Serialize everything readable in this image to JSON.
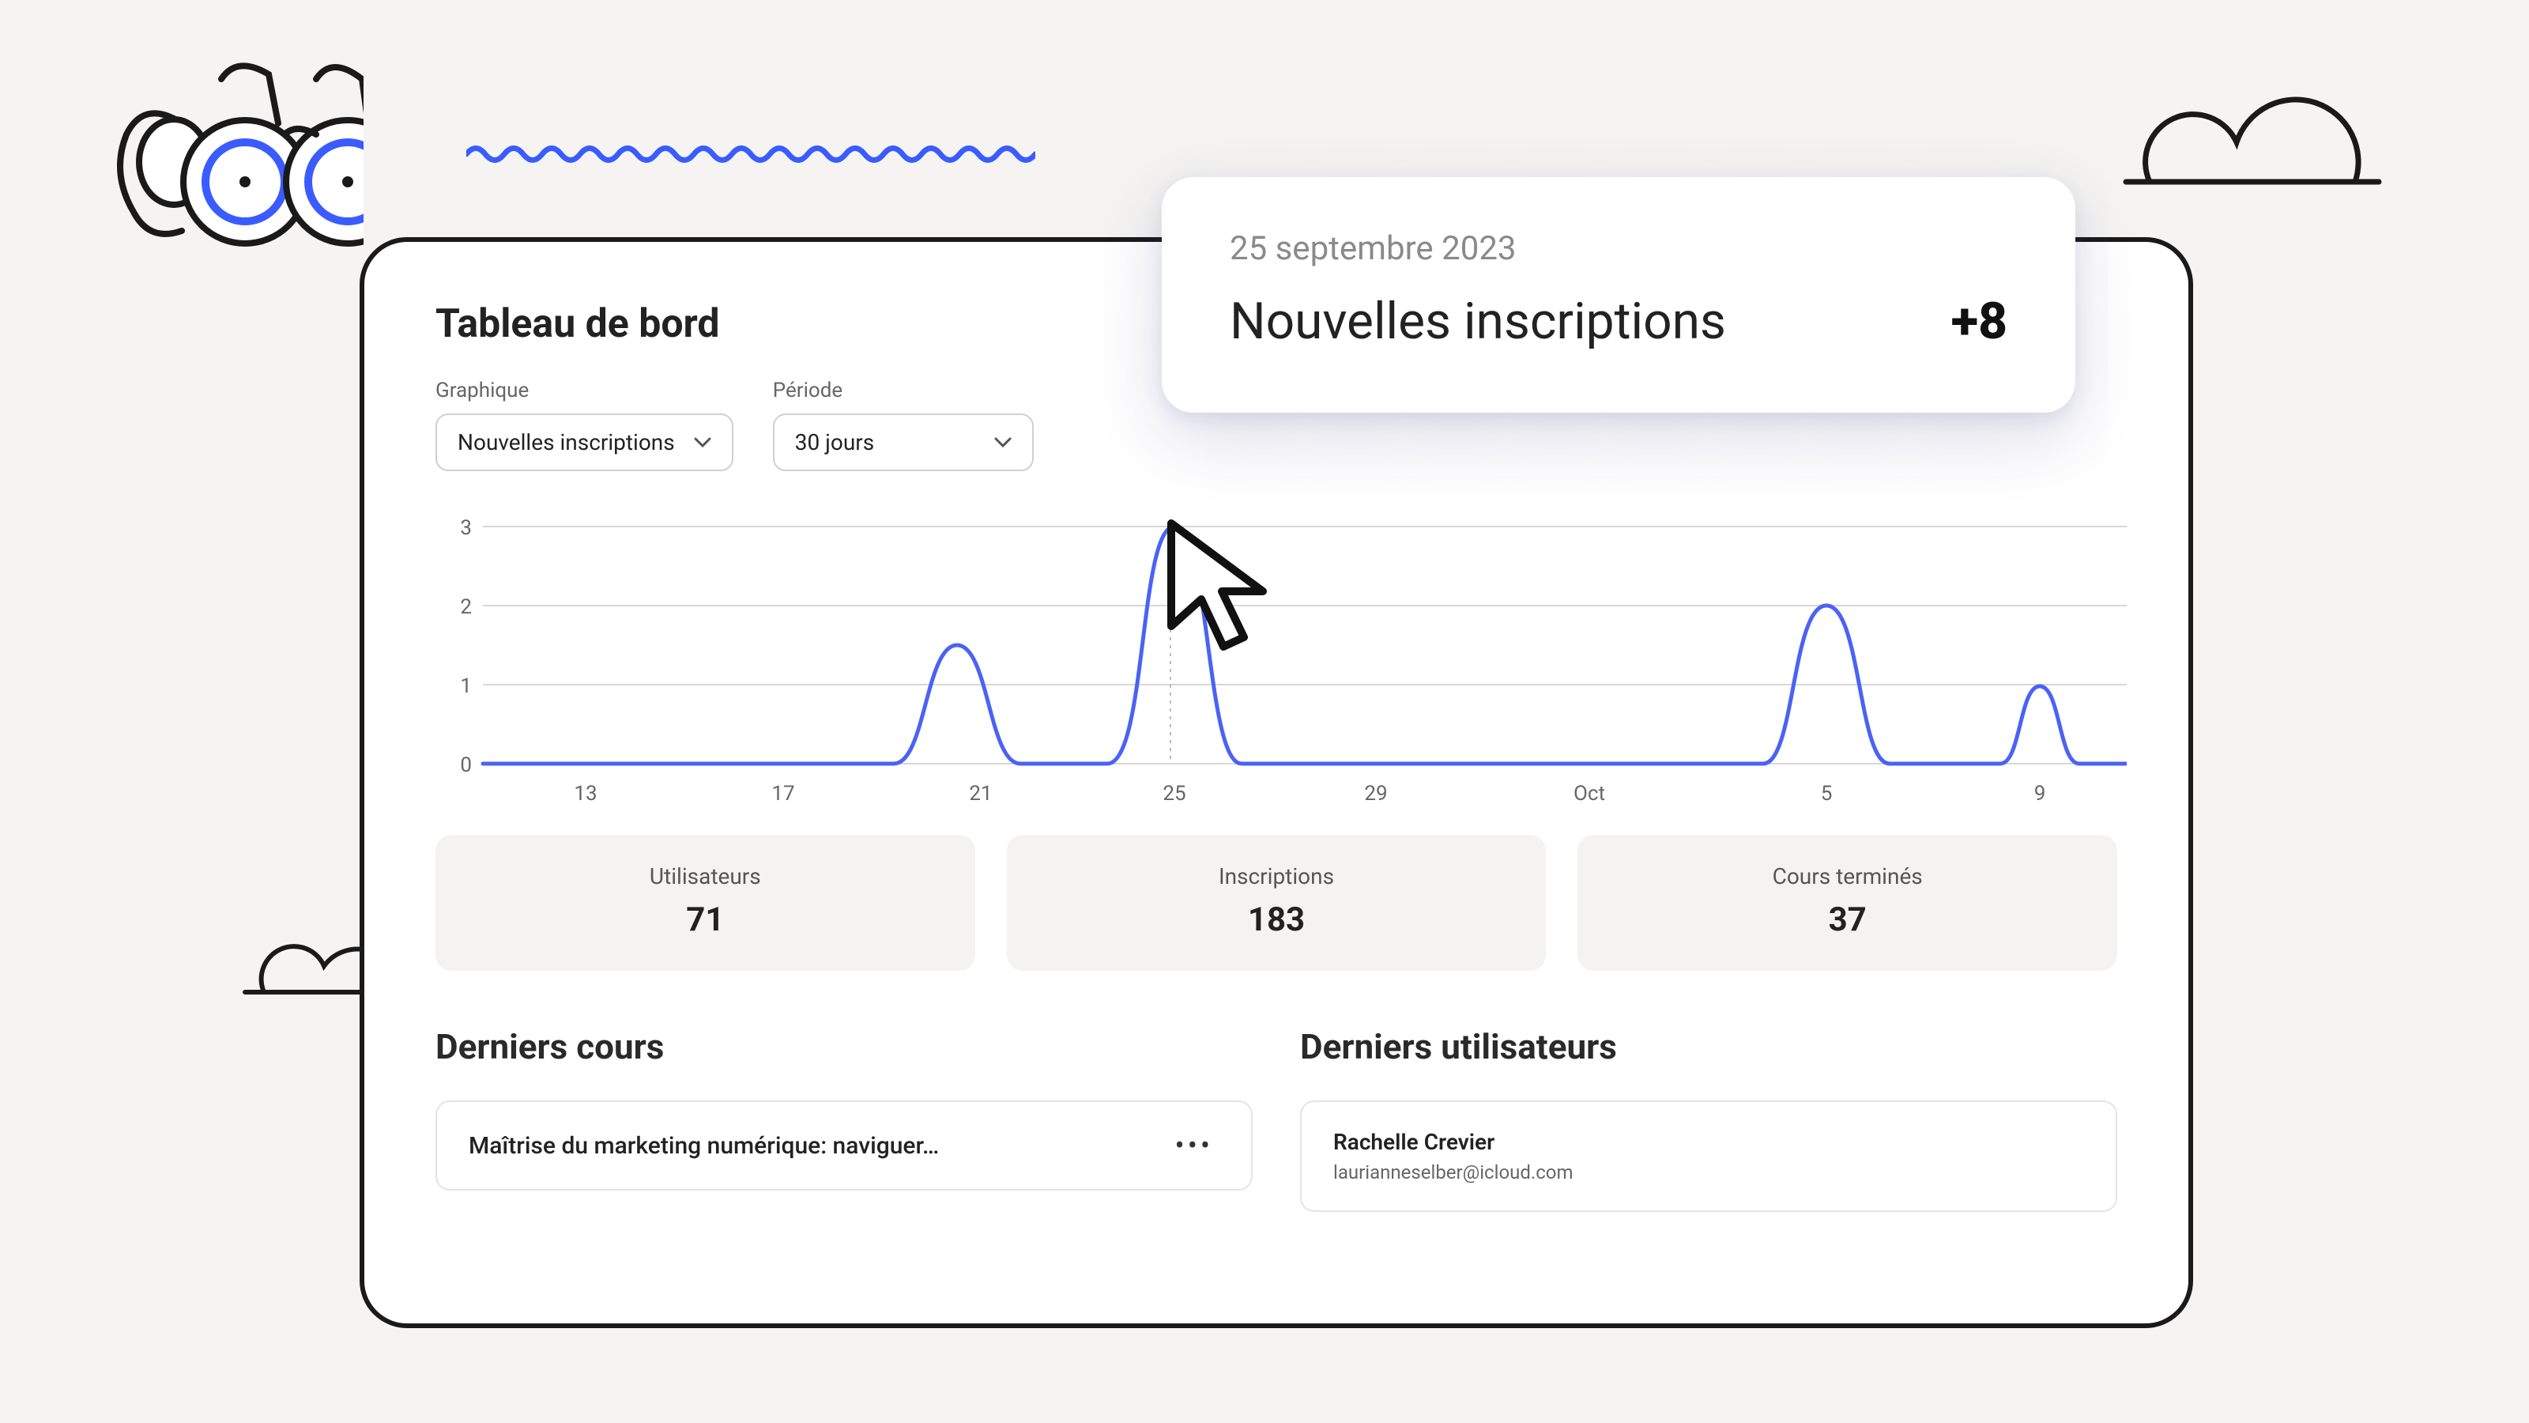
{
  "dashboard": {
    "title": "Tableau de bord",
    "filters": {
      "chart_label": "Graphique",
      "chart_value": "Nouvelles inscriptions",
      "period_label": "Période",
      "period_value": "30 jours"
    }
  },
  "chart_data": {
    "type": "line",
    "title": "",
    "xlabel": "",
    "ylabel": "",
    "ylim": [
      0,
      3
    ],
    "y_ticks": [
      0,
      1,
      2,
      3
    ],
    "x_ticks": [
      "13",
      "17",
      "21",
      "25",
      "29",
      "Oct",
      "5",
      "9"
    ],
    "series": [
      {
        "name": "Nouvelles inscriptions",
        "points": [
          {
            "x": "11",
            "y": 0
          },
          {
            "x": "12",
            "y": 0
          },
          {
            "x": "13",
            "y": 0
          },
          {
            "x": "14",
            "y": 0
          },
          {
            "x": "15",
            "y": 0
          },
          {
            "x": "16",
            "y": 0
          },
          {
            "x": "17",
            "y": 0
          },
          {
            "x": "18",
            "y": 0
          },
          {
            "x": "19",
            "y": 0
          },
          {
            "x": "20",
            "y": 0
          },
          {
            "x": "21",
            "y": 1.5
          },
          {
            "x": "22",
            "y": 0
          },
          {
            "x": "23",
            "y": 0
          },
          {
            "x": "24",
            "y": 0
          },
          {
            "x": "25",
            "y": 3
          },
          {
            "x": "26",
            "y": 0
          },
          {
            "x": "27",
            "y": 0
          },
          {
            "x": "28",
            "y": 0
          },
          {
            "x": "29",
            "y": 0
          },
          {
            "x": "30",
            "y": 0
          },
          {
            "x": "Oct",
            "y": 0
          },
          {
            "x": "2",
            "y": 0
          },
          {
            "x": "3",
            "y": 0
          },
          {
            "x": "4",
            "y": 0
          },
          {
            "x": "5",
            "y": 2
          },
          {
            "x": "6",
            "y": 0
          },
          {
            "x": "7",
            "y": 0
          },
          {
            "x": "8",
            "y": 0
          },
          {
            "x": "9",
            "y": 1
          },
          {
            "x": "10",
            "y": 0
          }
        ]
      }
    ],
    "hover": {
      "date": "25 septembre 2023",
      "label": "Nouvelles inscriptions",
      "value": "+8"
    }
  },
  "stats": [
    {
      "label": "Utilisateurs",
      "value": "71"
    },
    {
      "label": "Inscriptions",
      "value": "183"
    },
    {
      "label": "Cours terminés",
      "value": "37"
    }
  ],
  "panels": {
    "courses": {
      "title": "Derniers cours",
      "items": [
        {
          "title": "Maîtrise du marketing numérique: naviguer…"
        }
      ]
    },
    "users": {
      "title": "Derniers utilisateurs",
      "items": [
        {
          "name": "Rachelle Crevier",
          "email": "laurianneselber@icloud.com"
        }
      ]
    }
  },
  "colors": {
    "accent": "#3a5cff",
    "line": "#4a62f5"
  }
}
